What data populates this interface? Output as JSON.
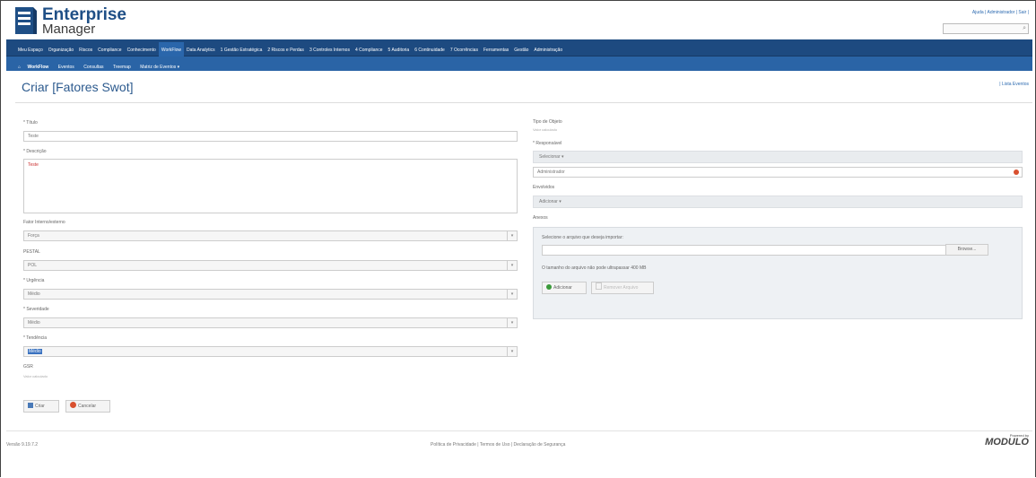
{
  "header": {
    "brand_line1": "Enterprise",
    "brand_line2": "Manager",
    "top_links": "Ajuda | Administrador | Sair |",
    "search_placeholder": "",
    "search_icon": "search-icon"
  },
  "nav_main": [
    "Meu Espaço",
    "Organização",
    "Riscos",
    "Compliance",
    "Conhecimento",
    "WorkFlow",
    "Data Analytics",
    "1 Gestão Estratégica",
    "2 Riscos e Perdas",
    "3 Controles Internos",
    "4 Compliance",
    "5 Auditoria",
    "6 Continuidade",
    "7 Ocorrências",
    "Ferramentas",
    "Gestão",
    "Administração"
  ],
  "nav_main_active": "WorkFlow",
  "nav_sub": [
    "WorkFlow",
    "Eventos",
    "Consultas",
    "Treemap",
    "Matriz de Eventos ▾"
  ],
  "page": {
    "title": "Criar [Fatores Swot]",
    "link": "| Lista Eventos"
  },
  "form": {
    "titulo_label": "* Título",
    "titulo_value": "Teste",
    "descricao_label": "* Descrição",
    "descricao_value": "Teste",
    "fator_label": "Fator Interno/externo",
    "fator_value": "Força",
    "pestal_label": "PESTAL",
    "pestal_value": "POL",
    "urgencia_label": "* Urgência",
    "urgencia_value": "Médio",
    "severidade_label": "* Severidade",
    "severidade_value": "Médio",
    "tendencia_label": "* Tendência",
    "tendencia_value": "Médio",
    "gsr_label": "GSR",
    "gsr_hint": "Valor calculado",
    "save_label": "Criar",
    "cancel_label": "Cancelar"
  },
  "right": {
    "tipo_label": "Tipo de Objeto",
    "tipo_hint": "Valor calculado",
    "resp_label": "* Responsável",
    "resp_select": "Selecionar ▾",
    "resp_value": "Administrador",
    "env_label": "Envolvidos",
    "env_select": "Adicionar ▾",
    "anexos_label": "Anexos",
    "file_prompt": "Selecione o arquivo que deseja importar:",
    "browse_label": "Browse...",
    "size_note": "O tamanho do arquivo não pode ultrapassar 400 MB",
    "add_label": "Adicionar",
    "remove_label": "Remover Arquivo"
  },
  "footer": {
    "version": "Versão 9.19.7.2",
    "links": "Política de Privacidade | Termos de Uso | Declaração de Segurança",
    "powered": "Powered by",
    "brand": "MODULO"
  },
  "colors": {
    "nav": "#1d4a80",
    "subnav": "#2a64a6",
    "title": "#2c5a8e"
  }
}
